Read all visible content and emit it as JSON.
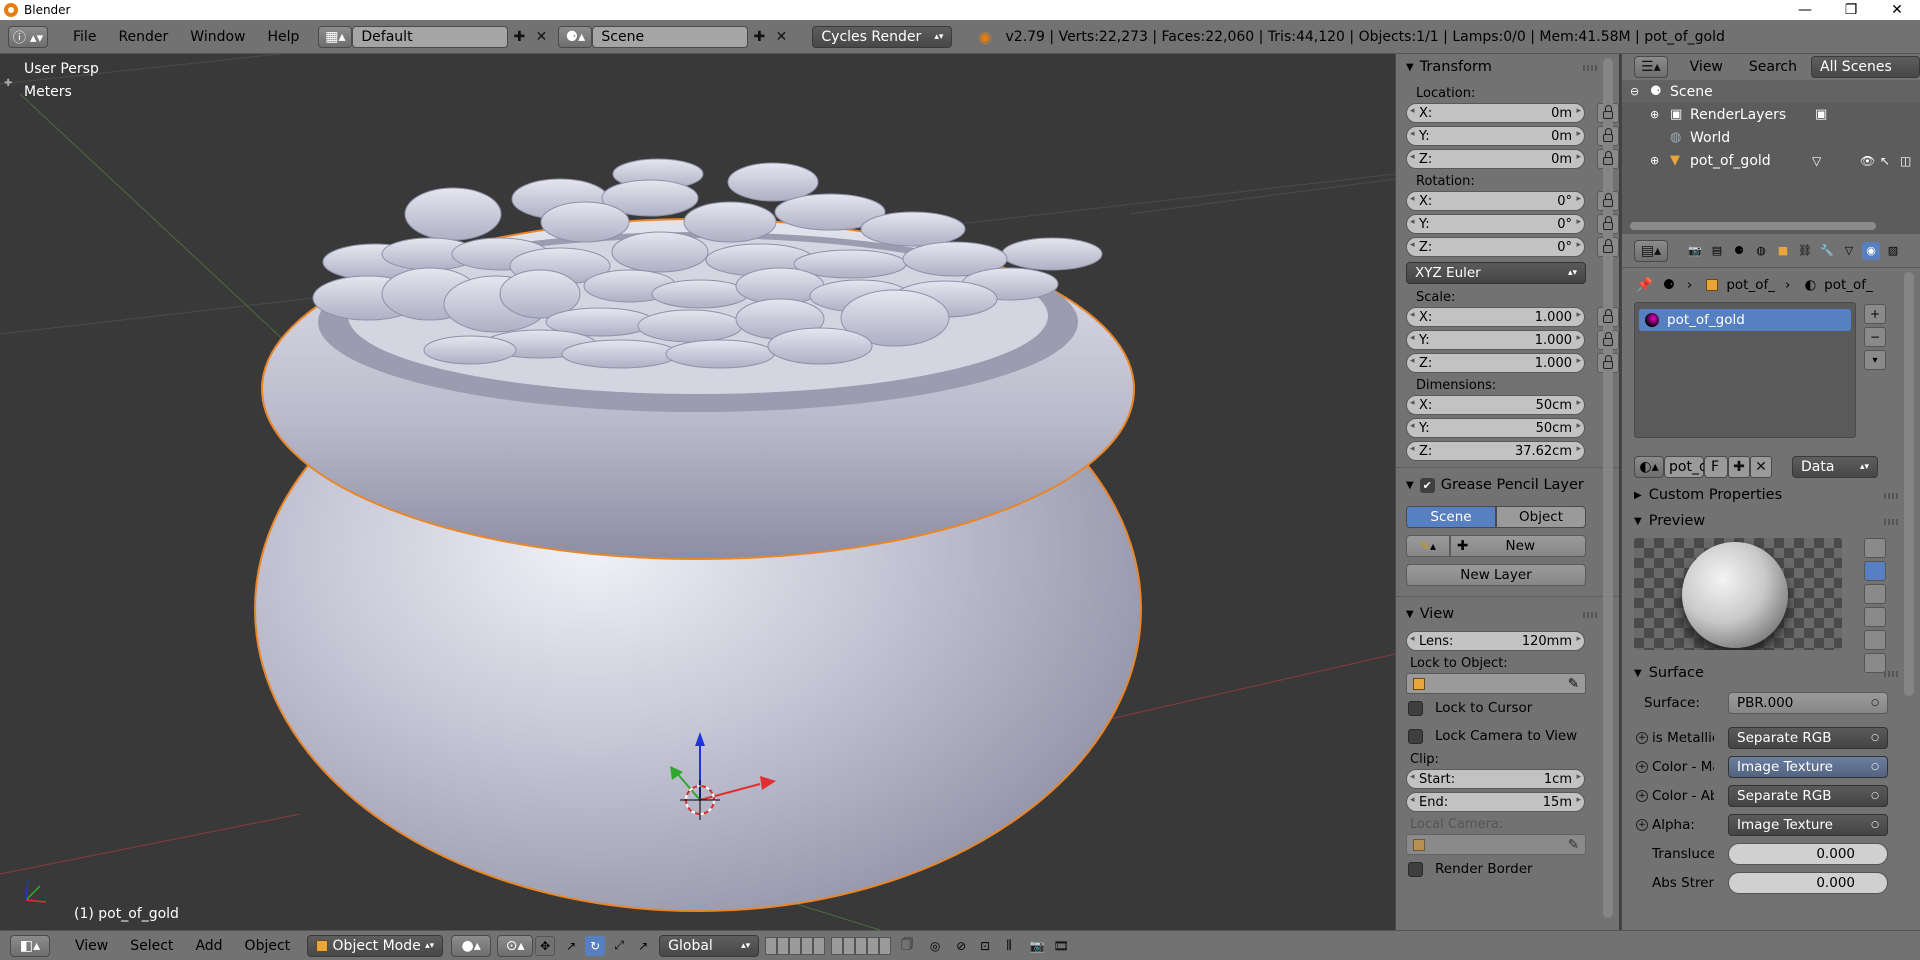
{
  "window": {
    "title": "Blender",
    "controls": [
      "—",
      "❐",
      "✕"
    ]
  },
  "info_header": {
    "menus": [
      "File",
      "Render",
      "Window",
      "Help"
    ],
    "layout_name": "Default",
    "scene_name": "Scene",
    "render_engine": "Cycles Render",
    "stats": "v2.79 | Verts:22,273 | Faces:22,060 | Tris:44,120 | Objects:1/1 | Lamps:0/0 | Mem:41.58M | pot_of_gold"
  },
  "viewport": {
    "view_label": "User Persp",
    "units_label": "Meters",
    "object_label": "(1) pot_of_gold"
  },
  "transform_panel": {
    "title": "Transform",
    "location_label": "Location:",
    "location": [
      {
        "axis": "X:",
        "value": "0m"
      },
      {
        "axis": "Y:",
        "value": "0m"
      },
      {
        "axis": "Z:",
        "value": "0m"
      }
    ],
    "rotation_label": "Rotation:",
    "rotation": [
      {
        "axis": "X:",
        "value": "0°"
      },
      {
        "axis": "Y:",
        "value": "0°"
      },
      {
        "axis": "Z:",
        "value": "0°"
      }
    ],
    "rotation_mode": "XYZ Euler",
    "scale_label": "Scale:",
    "scale": [
      {
        "axis": "X:",
        "value": "1.000"
      },
      {
        "axis": "Y:",
        "value": "1.000"
      },
      {
        "axis": "Z:",
        "value": "1.000"
      }
    ],
    "dimensions_label": "Dimensions:",
    "dimensions": [
      {
        "axis": "X:",
        "value": "50cm"
      },
      {
        "axis": "Y:",
        "value": "50cm"
      },
      {
        "axis": "Z:",
        "value": "37.62cm"
      }
    ]
  },
  "grease_pencil_panel": {
    "title": "Grease Pencil Layer",
    "tab_scene": "Scene",
    "tab_object": "Object",
    "new_label": "New",
    "new_layer_label": "New Layer"
  },
  "view_panel": {
    "title": "View",
    "lens_label": "Lens:",
    "lens_value": "120mm",
    "lock_to_object_label": "Lock to Object:",
    "lock_to_cursor": "Lock to Cursor",
    "lock_camera": "Lock Camera to View",
    "clip_label": "Clip:",
    "clip_start_label": "Start:",
    "clip_start": "1cm",
    "clip_end_label": "End:",
    "clip_end": "15m",
    "local_camera_label": "Local Camera:",
    "render_border": "Render Border"
  },
  "outliner": {
    "view_menu": "View",
    "search_menu": "Search",
    "filter": "All Scenes",
    "items": [
      {
        "label": "Scene"
      },
      {
        "label": "RenderLayers"
      },
      {
        "label": "World"
      },
      {
        "label": "pot_of_gold"
      }
    ]
  },
  "properties": {
    "breadcrumb_object": "pot_of_",
    "breadcrumb_material": "pot_of_",
    "material_slot": "pot_of_gold",
    "material_name": "pot_o",
    "fake_user": "F",
    "link_mode": "Data",
    "custom_properties": "Custom Properties",
    "preview": "Preview",
    "surface_title": "Surface",
    "surface_label": "Surface:",
    "surface_value": "PBR.000",
    "inputs": [
      {
        "label": "is Metallic",
        "value": "Separate RGB"
      },
      {
        "label": "Color - Ma",
        "value": "Image Texture"
      },
      {
        "label": "Color - Ab",
        "value": "Separate RGB"
      },
      {
        "label": "Alpha:",
        "value": "Image Texture"
      }
    ],
    "sliders": [
      {
        "label": "Transluce",
        "value": "0.000"
      },
      {
        "label": "Abs Stren",
        "value": "0.000"
      }
    ]
  },
  "bottom_header": {
    "menus": [
      "View",
      "Select",
      "Add",
      "Object"
    ],
    "mode": "Object Mode",
    "orientation": "Global"
  },
  "colors": {
    "header_bg": "#727272",
    "viewport_bg": "#393939",
    "selection_orange": "#e8862a",
    "highlight_blue": "#5680c2"
  }
}
